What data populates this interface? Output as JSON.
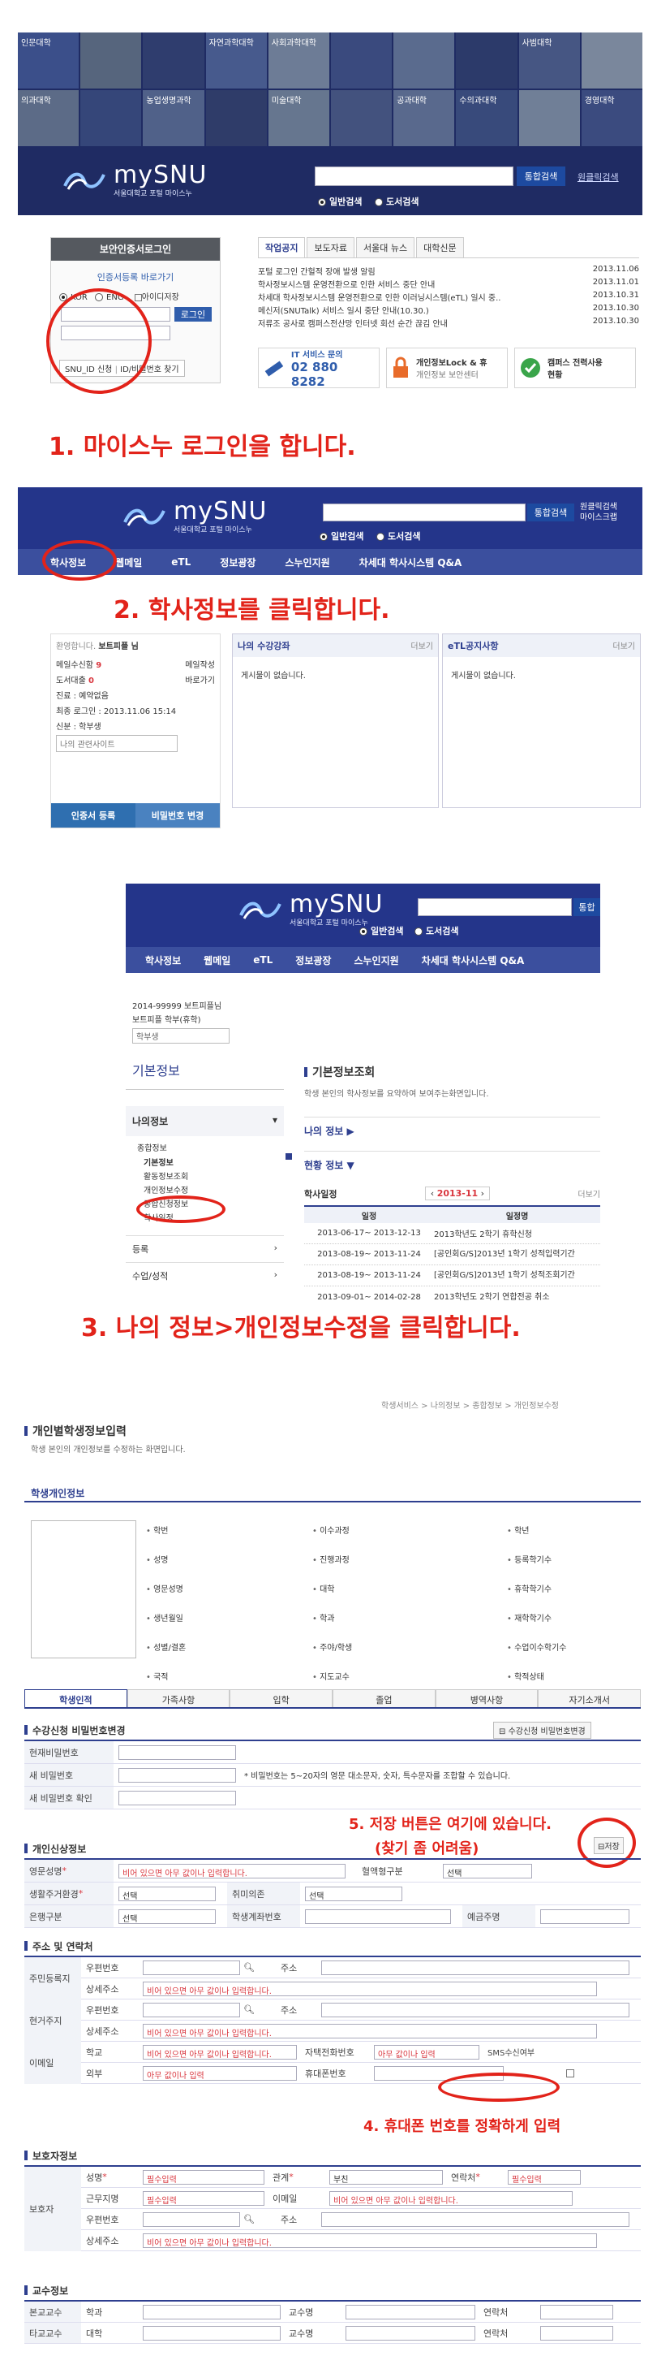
{
  "step1": {
    "banner_labels": [
      "인문대학",
      "사회과학대학",
      "자연과학대학",
      "사범대학",
      "의과대학",
      "농업생명과학",
      "미술대학",
      "수의과대학",
      "공과대학",
      "경영대학"
    ],
    "logo_text": "mySNU",
    "logo_sub": "서울대학교 포털 마이스누",
    "search_button": "통합검색",
    "site_map": "원클릭검색",
    "radio_general": "일반검색",
    "radio_library": "도서검색",
    "login_title": "보안인증서로그인",
    "cert_link": "인증서등록 바로가기",
    "lang_kor": "KOR",
    "lang_eng": "ENG",
    "id_save": "아이디저장",
    "login_button": "로그인",
    "id_apply_link": "SNU_ID 신청",
    "id_pw_find_link": "ID/비밀번호 찾기",
    "notice_tabs": [
      "작업공지",
      "보도자료",
      "서울대 뉴스",
      "대학신문"
    ],
    "notices": [
      {
        "title": "포털 로그인 간헐적 장애 발생 알림",
        "date": "2013.11.06"
      },
      {
        "title": "학사정보시스템 운영전환으로 인한 서비스 중단 안내",
        "date": "2013.11.01"
      },
      {
        "title": "차세대 학사정보시스템 운영전환으로 인한 이러닝시스템(eTL) 일시 중..",
        "date": "2013.10.31"
      },
      {
        "title": "메신저(SNUTalk) 서비스 일시 중단 안내(10.30.)",
        "date": "2013.10.30"
      },
      {
        "title": "저류조 공사로 캠퍼스전산망 인터넷 회선 순간 끊김 안내",
        "date": "2013.10.30"
      }
    ],
    "service_it_title": "IT 서비스 문의",
    "service_it_phone": "02 880 8282",
    "service_lock_title": "개인정보Lock & 휴",
    "service_lock_sub": "개인정보 보안센터",
    "service_campus_title": "캠퍼스 전력사용",
    "service_campus_sub": "현황",
    "caption": "1. 마이스누 로그인을 합니다."
  },
  "step2": {
    "logo_text": "mySNU",
    "logo_sub": "서울대학교 포털 마이스누",
    "search_button": "통합검색",
    "quick_links": [
      "원클릭검색",
      "마이스크랩"
    ],
    "radio_general": "일반검색",
    "radio_library": "도서검색",
    "nav": [
      "학사정보",
      "웹메일",
      "eTL",
      "정보광장",
      "스누인지원",
      "차세대 학사시스템 Q&A"
    ],
    "caption": "2. 학사정보를 클릭합니다.",
    "welcome_prefix": "환영합니다.",
    "welcome_name": "보트피플 님",
    "left_items": [
      {
        "label": "메일수신함",
        "count": "9",
        "right": "메일작성"
      },
      {
        "label": "도서대출",
        "count": "0",
        "right": "바로가기"
      }
    ],
    "role_line": "진료 : 예약없음",
    "login_time": "최종 로그인 : 2013.11.06 15:14",
    "status_line": "신분 : 학부생",
    "related_site": "나의 관련사이트",
    "cert_button": "인증서 등록",
    "pw_button": "비밀번호 변경",
    "panel1_title": "나의 수강강좌",
    "panel1_more": "더보기",
    "panel1_empty": "게시물이 없습니다.",
    "panel2_title": "eTL공지사항",
    "panel2_more": "더보기",
    "panel2_empty": "게시물이 없습니다."
  },
  "step3": {
    "logo_text": "mySNU",
    "logo_sub": "서울대학교 포털 마이스누",
    "search_button": "통합",
    "radio_general": "일반검색",
    "radio_library": "도서검색",
    "nav": [
      "학사정보",
      "웹메일",
      "eTL",
      "정보광장",
      "스누인지원",
      "차세대 학사시스템 Q&A"
    ],
    "student_id": "2014-99999 보트피플님",
    "student_name_line": "보트피플 학부(휴학)",
    "dept_select": "학부생",
    "basic_info": "기본정보",
    "my_info": "나의정보",
    "menu_group": "종합정보",
    "menu_items": [
      "기본정보",
      "활동정보조회",
      "개인정보수정",
      "종합신청정보",
      "학사일정"
    ],
    "menu_register": "등록",
    "menu_course": "수업/성적",
    "right_title": "기본정보조회",
    "right_desc": "학생 본인의 학사정보를 요약하여 보여주는화면입니다.",
    "my_info_link": "나의 정보 ▶",
    "status_link": "현황 정보 ▼",
    "calendar_title": "학사일정",
    "calendar_month": "2013-11",
    "calendar_more": "더보기",
    "calendar_headers": [
      "일정",
      "일정명"
    ],
    "calendar_rows": [
      {
        "period": "2013-06-17~ 2013-12-13",
        "name": "2013학년도 2학기 휴학신청"
      },
      {
        "period": "2013-08-19~ 2013-11-24",
        "name": "[공인회G/S]2013년 1학기 성적입력기간"
      },
      {
        "period": "2013-08-19~ 2013-11-24",
        "name": "[공인회G/S]2013년 1학기 성적조회기간"
      },
      {
        "period": "2013-09-01~ 2014-02-28",
        "name": "2013학년도 2학기 연합전공 취소"
      }
    ],
    "caption": "3. 나의 정보>개인정보수정을 클릭합니다."
  },
  "step4": {
    "breadcrumb": "학생서비스 > 나의정보 > 종합정보 > 개인정보수정",
    "page_title": "개인별학생정보입력",
    "page_desc": "학생 본인의 개인정보를 수정하는 화면입니다.",
    "profile_title": "학생개인정보",
    "profile_fields": [
      [
        "학번",
        "이수과정",
        "학년"
      ],
      [
        "성명",
        "진행과정",
        "등록학기수"
      ],
      [
        "영문성명",
        "대학",
        "휴학학기수"
      ],
      [
        "생년월일",
        "학과",
        "재학학기수"
      ],
      [
        "성별/결혼",
        "주야/학생",
        "수업이수학기수"
      ],
      [
        "국적",
        "지도교수",
        "학적상태"
      ]
    ],
    "tabs": [
      "학생인적",
      "가족사항",
      "입학",
      "졸업",
      "병역사항",
      "자기소개서"
    ],
    "pw_section_title": "수강신청 비밀번호변경",
    "pw_change_button": "수강신청 비밀번호변경",
    "pw_rows": [
      "현재비밀번호",
      "새 비밀번호",
      "새 비밀번호 확인"
    ],
    "pw_hint": "* 비밀번호는 5~20자의 영문 대소문자, 숫자, 특수문자를 조합할 수 있습니다.",
    "note5_line1": "5. 저장 버튼은 여기에 있습니다.",
    "note5_line2": "(찾기 좀 어려움)",
    "save_button": "저장",
    "personal_title": "개인신상정보",
    "personal_rows": [
      {
        "l1": "영문성명",
        "v1": "비어 있으면 아무 값이나 입력합니다.",
        "l2": "혈액형구분",
        "v2": "선택"
      },
      {
        "l1": "생활주거환경",
        "v1": "선택",
        "l2": "취미의존",
        "v2": "선택"
      },
      {
        "l1": "은행구분",
        "v1": "선택",
        "l2": "학생계좌번호",
        "v2": "",
        "l3": "예금주명"
      }
    ],
    "address_title": "주소 및 연락처",
    "zip_label": "우편번호",
    "addr_label": "주소",
    "detail_label": "상세주소",
    "empty_hint": "비어 있으면 아무 값이나 입력합니다.",
    "addr_groups": [
      "주민등록지",
      "현거주지"
    ],
    "email_label": "이메일",
    "email_school": "학교",
    "email_outside": "외부",
    "home_phone": "자택전화번호",
    "mobile": "휴대폰번호",
    "sms_label": "SMS수신여부",
    "any_value": "아무 값이나 입력",
    "note4": "4. 휴대폰 번호를 정확하게 입력",
    "guardian_title": "보호자정보",
    "guardian_label": "보호자",
    "g_name": "성명",
    "g_required": "필수입력",
    "g_relation": "관계",
    "g_relation_val": "부친",
    "g_contact": "연락처",
    "g_work": "근무지명",
    "g_email": "이메일",
    "prof_title": "교수정보",
    "prof_rows": [
      {
        "label": "본교교수",
        "a": "학과",
        "b": "교수명",
        "c": "연락처"
      },
      {
        "label": "타교교수",
        "a": "대학",
        "b": "교수명",
        "c": "연락처"
      }
    ]
  }
}
